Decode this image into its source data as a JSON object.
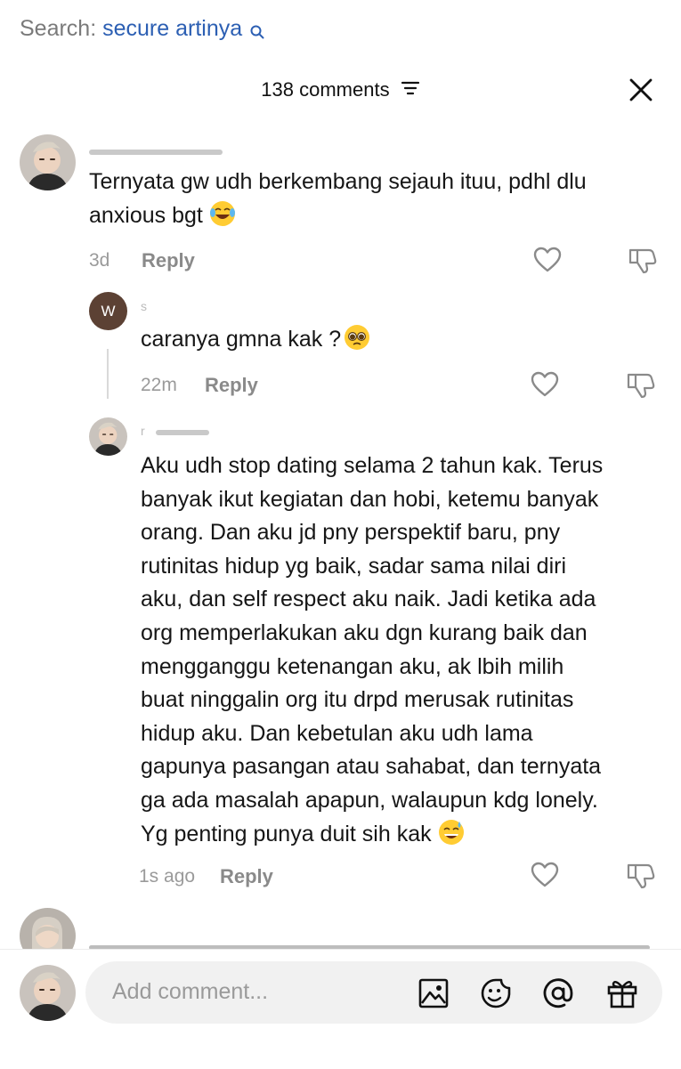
{
  "search": {
    "label": "Search:",
    "query": "secure artinya",
    "icon": "search-icon"
  },
  "header": {
    "count_label": "138 comments",
    "sort_icon": "sort-icon",
    "close_icon": "close-icon"
  },
  "comments": [
    {
      "text_line1": "Ternyata gw udh berkembang sejauh ituu, pdhl dlu",
      "text_line2": "anxious bgt",
      "emoji": "joy-emoji",
      "time": "3d",
      "reply_label": "Reply"
    },
    {
      "avatar_letter": "W",
      "username_fragment": "s",
      "text": "caranya gmna kak ?",
      "emoji": "pleading-emoji",
      "time": "22m",
      "reply_label": "Reply"
    },
    {
      "username_fragment": "r",
      "lines": [
        "Aku udh stop dating selama 2 tahun kak. Terus",
        "banyak ikut kegiatan dan hobi, ketemu banyak",
        "orang. Dan aku jd pny perspektif baru, pny",
        "rutinitas hidup yg baik, sadar sama nilai diri",
        "aku, dan self respect aku naik. Jadi ketika ada",
        "org memperlakukan aku dgn kurang baik dan",
        "mengganggu ketenangan aku, ak lbih milih",
        "buat ninggalin org itu drpd merusak rutinitas",
        "hidup aku. Dan kebetulan aku udh lama",
        "gapunya pasangan atau sahabat, dan ternyata",
        "ga ada masalah apapun, walaupun kdg lonely.",
        "Yg penting punya duit sih kak"
      ],
      "emoji": "sweat-smile-emoji",
      "time": "1s ago",
      "reply_label": "Reply"
    }
  ],
  "footer": {
    "placeholder": "Add comment...",
    "icons": [
      "image-icon",
      "emoji-sticker-icon",
      "mention-icon",
      "gift-icon"
    ]
  }
}
